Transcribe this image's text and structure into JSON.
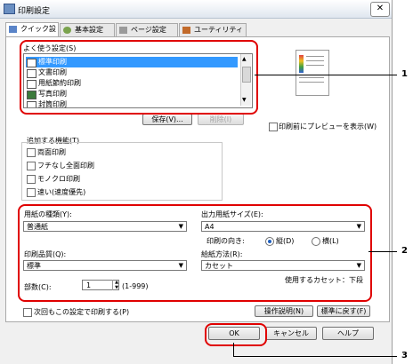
{
  "window": {
    "title": "印刷設定",
    "close_glyph": "✕"
  },
  "tabs": [
    {
      "label": "クイック設定",
      "active": true
    },
    {
      "label": "基本設定",
      "active": false
    },
    {
      "label": "ページ設定",
      "active": false
    },
    {
      "label": "ユーティリティ",
      "active": false
    }
  ],
  "favorites": {
    "label": "よく使う設定(S)",
    "items": [
      {
        "label": "標準印刷",
        "selected": true
      },
      {
        "label": "文書印刷",
        "selected": false
      },
      {
        "label": "用紙節約印刷",
        "selected": false
      },
      {
        "label": "写真印刷",
        "selected": false
      },
      {
        "label": "封筒印刷",
        "selected": false
      }
    ],
    "save_button": "保存(V)...",
    "delete_button": "削除(I)",
    "preview_checkbox": "印刷前にプレビューを表示(W)"
  },
  "additional": {
    "label": "追加する機能(T)",
    "options": [
      "両面印刷",
      "フチなし全面印刷",
      "モノクロ印刷",
      "速い(速度優先)"
    ]
  },
  "settings": {
    "media_label": "用紙の種類(Y):",
    "media_value": "普通紙",
    "output_size_label": "出力用紙サイズ(E):",
    "output_size_value": "A4",
    "orientation_label": "印刷の向き:",
    "portrait_label": "縦(D)",
    "landscape_label": "横(L)",
    "quality_label": "印刷品質(Q):",
    "quality_value": "標準",
    "source_label": "給紙方法(R):",
    "source_value": "カセット",
    "cassette_note": "使用するカセット：下段",
    "copies_label": "部数(C):",
    "copies_value": "1",
    "copies_range": "(1-999)"
  },
  "bottom": {
    "always_checkbox": "次回もこの設定で印刷する(P)",
    "instructions_button": "操作説明(N)",
    "defaults_button": "標準に戻す(F)"
  },
  "dialog_buttons": {
    "ok": "OK",
    "cancel": "キャンセル",
    "help": "ヘルプ"
  },
  "callouts": [
    "1",
    "2",
    "3"
  ],
  "colors": {
    "callout": "#e00000",
    "selection": "#3399ff"
  }
}
